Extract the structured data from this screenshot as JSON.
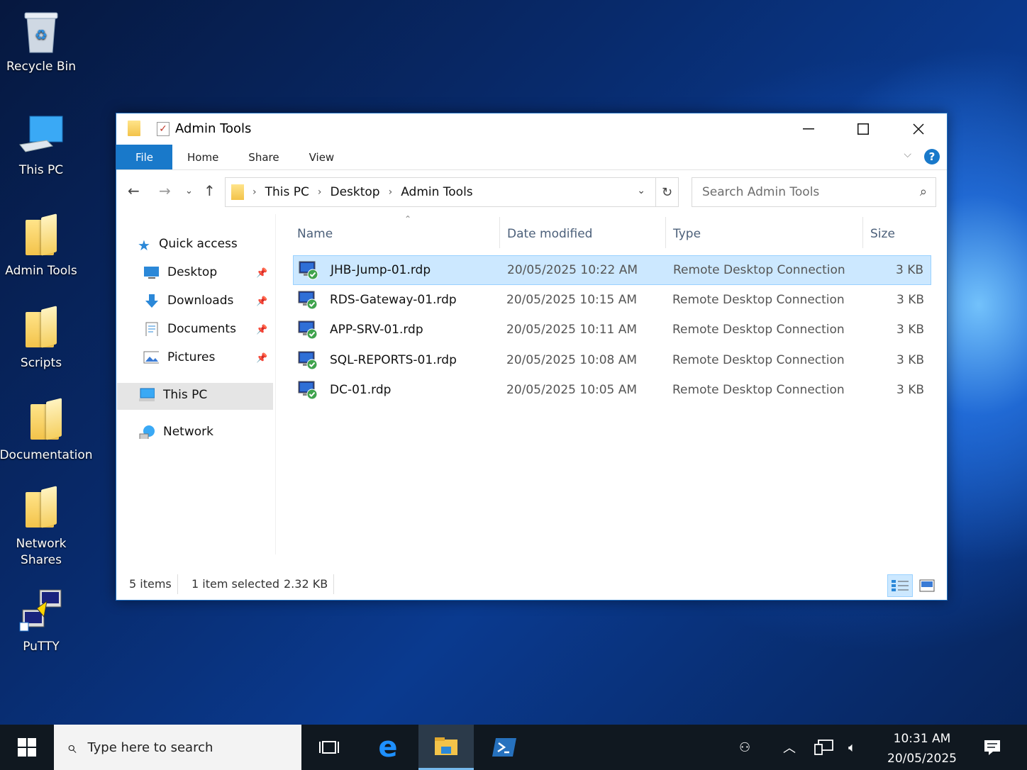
{
  "desktop": {
    "icons": [
      {
        "label": "Recycle Bin"
      },
      {
        "label": "This PC"
      },
      {
        "label": "Admin Tools"
      },
      {
        "label": "Scripts"
      },
      {
        "label": "Documentation"
      },
      {
        "label": "Network Shares"
      },
      {
        "label": "PuTTY"
      }
    ]
  },
  "window": {
    "title": "Admin Tools",
    "ribbon": {
      "tabs": [
        "File",
        "Home",
        "Share",
        "View"
      ],
      "help": "?"
    },
    "address": {
      "crumbs": [
        "This PC",
        "Desktop",
        "Admin Tools"
      ]
    },
    "search": {
      "placeholder": "Search Admin Tools"
    },
    "sidebar": {
      "quick_access": "Quick access",
      "items": [
        "Desktop",
        "Downloads",
        "Documents",
        "Pictures"
      ],
      "this_pc": "This PC",
      "network": "Network"
    },
    "columns": {
      "name": "Name",
      "date": "Date modified",
      "type": "Type",
      "size": "Size"
    },
    "files": [
      {
        "name": "JHB-Jump-01.rdp",
        "date": "20/05/2025 10:22 AM",
        "type": "Remote Desktop Connection",
        "size": "3 KB"
      },
      {
        "name": "RDS-Gateway-01.rdp",
        "date": "20/05/2025 10:15 AM",
        "type": "Remote Desktop Connection",
        "size": "3 KB"
      },
      {
        "name": "APP-SRV-01.rdp",
        "date": "20/05/2025 10:11 AM",
        "type": "Remote Desktop Connection",
        "size": "3 KB"
      },
      {
        "name": "SQL-REPORTS-01.rdp",
        "date": "20/05/2025 10:08 AM",
        "type": "Remote Desktop Connection",
        "size": "3 KB"
      },
      {
        "name": "DC-01.rdp",
        "date": "20/05/2025 10:05 AM",
        "type": "Remote Desktop Connection",
        "size": "3 KB"
      }
    ],
    "status": {
      "count": "5 items",
      "selected": "1 item selected",
      "size": "2.32 KB"
    }
  },
  "taskbar": {
    "search_placeholder": "Type here to search",
    "time": "10:31 AM",
    "date": "20/05/2025"
  },
  "colors": {
    "accent": "#1979ca",
    "selection": "#cce8ff"
  }
}
